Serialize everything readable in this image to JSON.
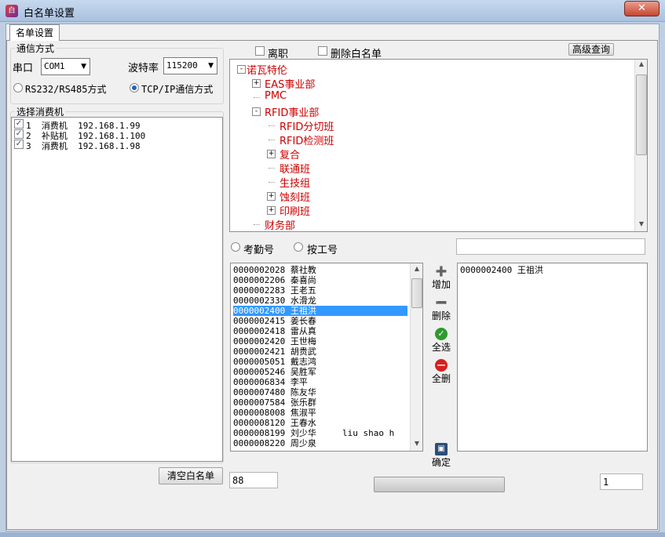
{
  "window": {
    "title": "白名单设置",
    "app_icon_label": "白",
    "close_label": "✕"
  },
  "tabs": [
    {
      "label": "名单设置",
      "active": true
    }
  ],
  "comm": {
    "group_label": "通信方式",
    "port_label": "串口",
    "port_value": "COM1",
    "baud_label": "波特率",
    "baud_value": "115200",
    "mode_rs": "RS232/RS485方式",
    "mode_tcp": "TCP/IP通信方式",
    "selected_mode": "tcp"
  },
  "machines": {
    "group_label": "选择消费机",
    "items": [
      {
        "checked": true,
        "text": "1  消费机  192.168.1.99"
      },
      {
        "checked": true,
        "text": "2  补贴机  192.168.1.100"
      },
      {
        "checked": true,
        "text": "3  消费机  192.168.1.98"
      }
    ]
  },
  "clear_whitelist_label": "清空白名单",
  "filters": {
    "resigned_label": "离职",
    "delete_whitelist_label": "删除白名单",
    "advanced_query_label": "高级查询"
  },
  "tree": {
    "root": "诺瓦特伦",
    "nodes": [
      {
        "label": "EAS事业部",
        "level": 1,
        "expander": "+"
      },
      {
        "label": "PMC",
        "level": 1,
        "expander": ""
      },
      {
        "label": "RFID事业部",
        "level": 1,
        "expander": "-"
      },
      {
        "label": "RFID分切班",
        "level": 2,
        "expander": ""
      },
      {
        "label": "RFID检测班",
        "level": 2,
        "expander": ""
      },
      {
        "label": "复合",
        "level": 2,
        "expander": "+"
      },
      {
        "label": "联通班",
        "level": 2,
        "expander": ""
      },
      {
        "label": "生技组",
        "level": 2,
        "expander": ""
      },
      {
        "label": "蚀刻班",
        "level": 2,
        "expander": "+"
      },
      {
        "label": "印刷班",
        "level": 2,
        "expander": "+"
      },
      {
        "label": "财务部",
        "level": 1,
        "expander": ""
      }
    ]
  },
  "search": {
    "by_attendance_label": "考勤号",
    "by_employee_label": "按工号",
    "input_value": ""
  },
  "employees": {
    "selected_index": 4,
    "items": [
      "0000002028 蔡社教",
      "0000002206 秦喜尚",
      "0000002283 王老五",
      "0000002330 水滑龙",
      "0000002400 王祖洪",
      "0000002415 姜长春",
      "0000002418 雷从真",
      "0000002420 王世梅",
      "0000002421 胡贵武",
      "0000005051 戴志鸿",
      "0000005246 吴胜军",
      "0000006834 李平",
      "0000007480 陈友华",
      "0000007584 张乐群",
      "0000008008 焦淑平",
      "0000008120 王春水",
      "0000008199 刘少华     liu shao h",
      "0000008220 周少泉"
    ]
  },
  "actions": {
    "add_label": "增加",
    "delete_label": "删除",
    "select_all_label": "全选",
    "delete_all_label": "全删",
    "confirm_label": "确定"
  },
  "whitelist": {
    "items": [
      "0000002400 王祖洪"
    ]
  },
  "count_value": "88",
  "page_value": "1",
  "progress_fraction": 0,
  "colors": {
    "tree_text": "#cc0000",
    "selection": "#3399ff"
  }
}
